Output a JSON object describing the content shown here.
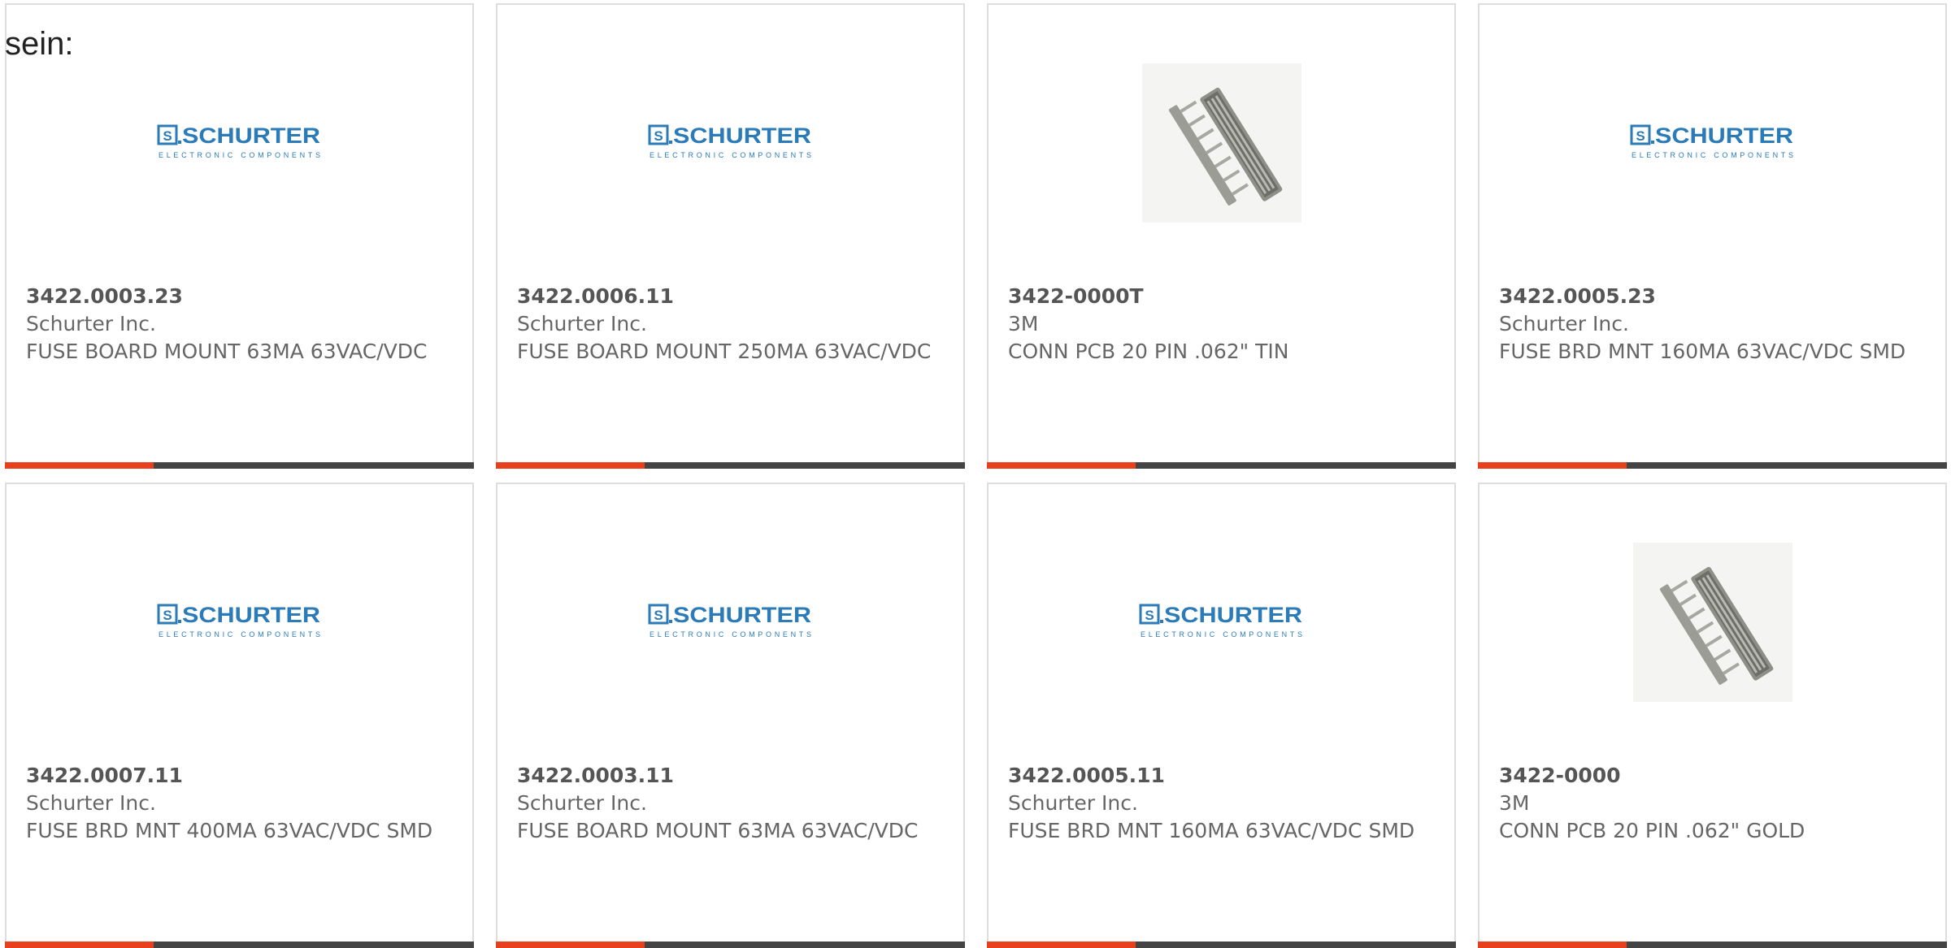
{
  "intro_text": "sein:",
  "colors": {
    "accent": "#e8401c",
    "bar": "#444444",
    "logo_blue": "#2a7bb8"
  },
  "logo": {
    "name": "SCHURTER",
    "tagline": "ELECTRONIC COMPONENTS"
  },
  "products": [
    {
      "part_number": "3422.0003.23",
      "manufacturer": "Schurter Inc.",
      "description": "FUSE BOARD MOUNT 63MA 63VAC/VDC",
      "image": "schurter-logo"
    },
    {
      "part_number": "3422.0006.11",
      "manufacturer": "Schurter Inc.",
      "description": "FUSE BOARD MOUNT 250MA 63VAC/VDC",
      "image": "schurter-logo"
    },
    {
      "part_number": "3422-0000T",
      "manufacturer": "3M",
      "description": "CONN PCB 20 PIN .062\" TIN",
      "image": "connector-photo"
    },
    {
      "part_number": "3422.0005.23",
      "manufacturer": "Schurter Inc.",
      "description": "FUSE BRD MNT 160MA 63VAC/VDC SMD",
      "image": "schurter-logo"
    },
    {
      "part_number": "3422.0007.11",
      "manufacturer": "Schurter Inc.",
      "description": "FUSE BRD MNT 400MA 63VAC/VDC SMD",
      "image": "schurter-logo"
    },
    {
      "part_number": "3422.0003.11",
      "manufacturer": "Schurter Inc.",
      "description": "FUSE BOARD MOUNT 63MA 63VAC/VDC",
      "image": "schurter-logo"
    },
    {
      "part_number": "3422.0005.11",
      "manufacturer": "Schurter Inc.",
      "description": "FUSE BRD MNT 160MA 63VAC/VDC SMD",
      "image": "schurter-logo"
    },
    {
      "part_number": "3422-0000",
      "manufacturer": "3M",
      "description": "CONN PCB 20 PIN .062\" GOLD",
      "image": "connector-photo"
    }
  ]
}
